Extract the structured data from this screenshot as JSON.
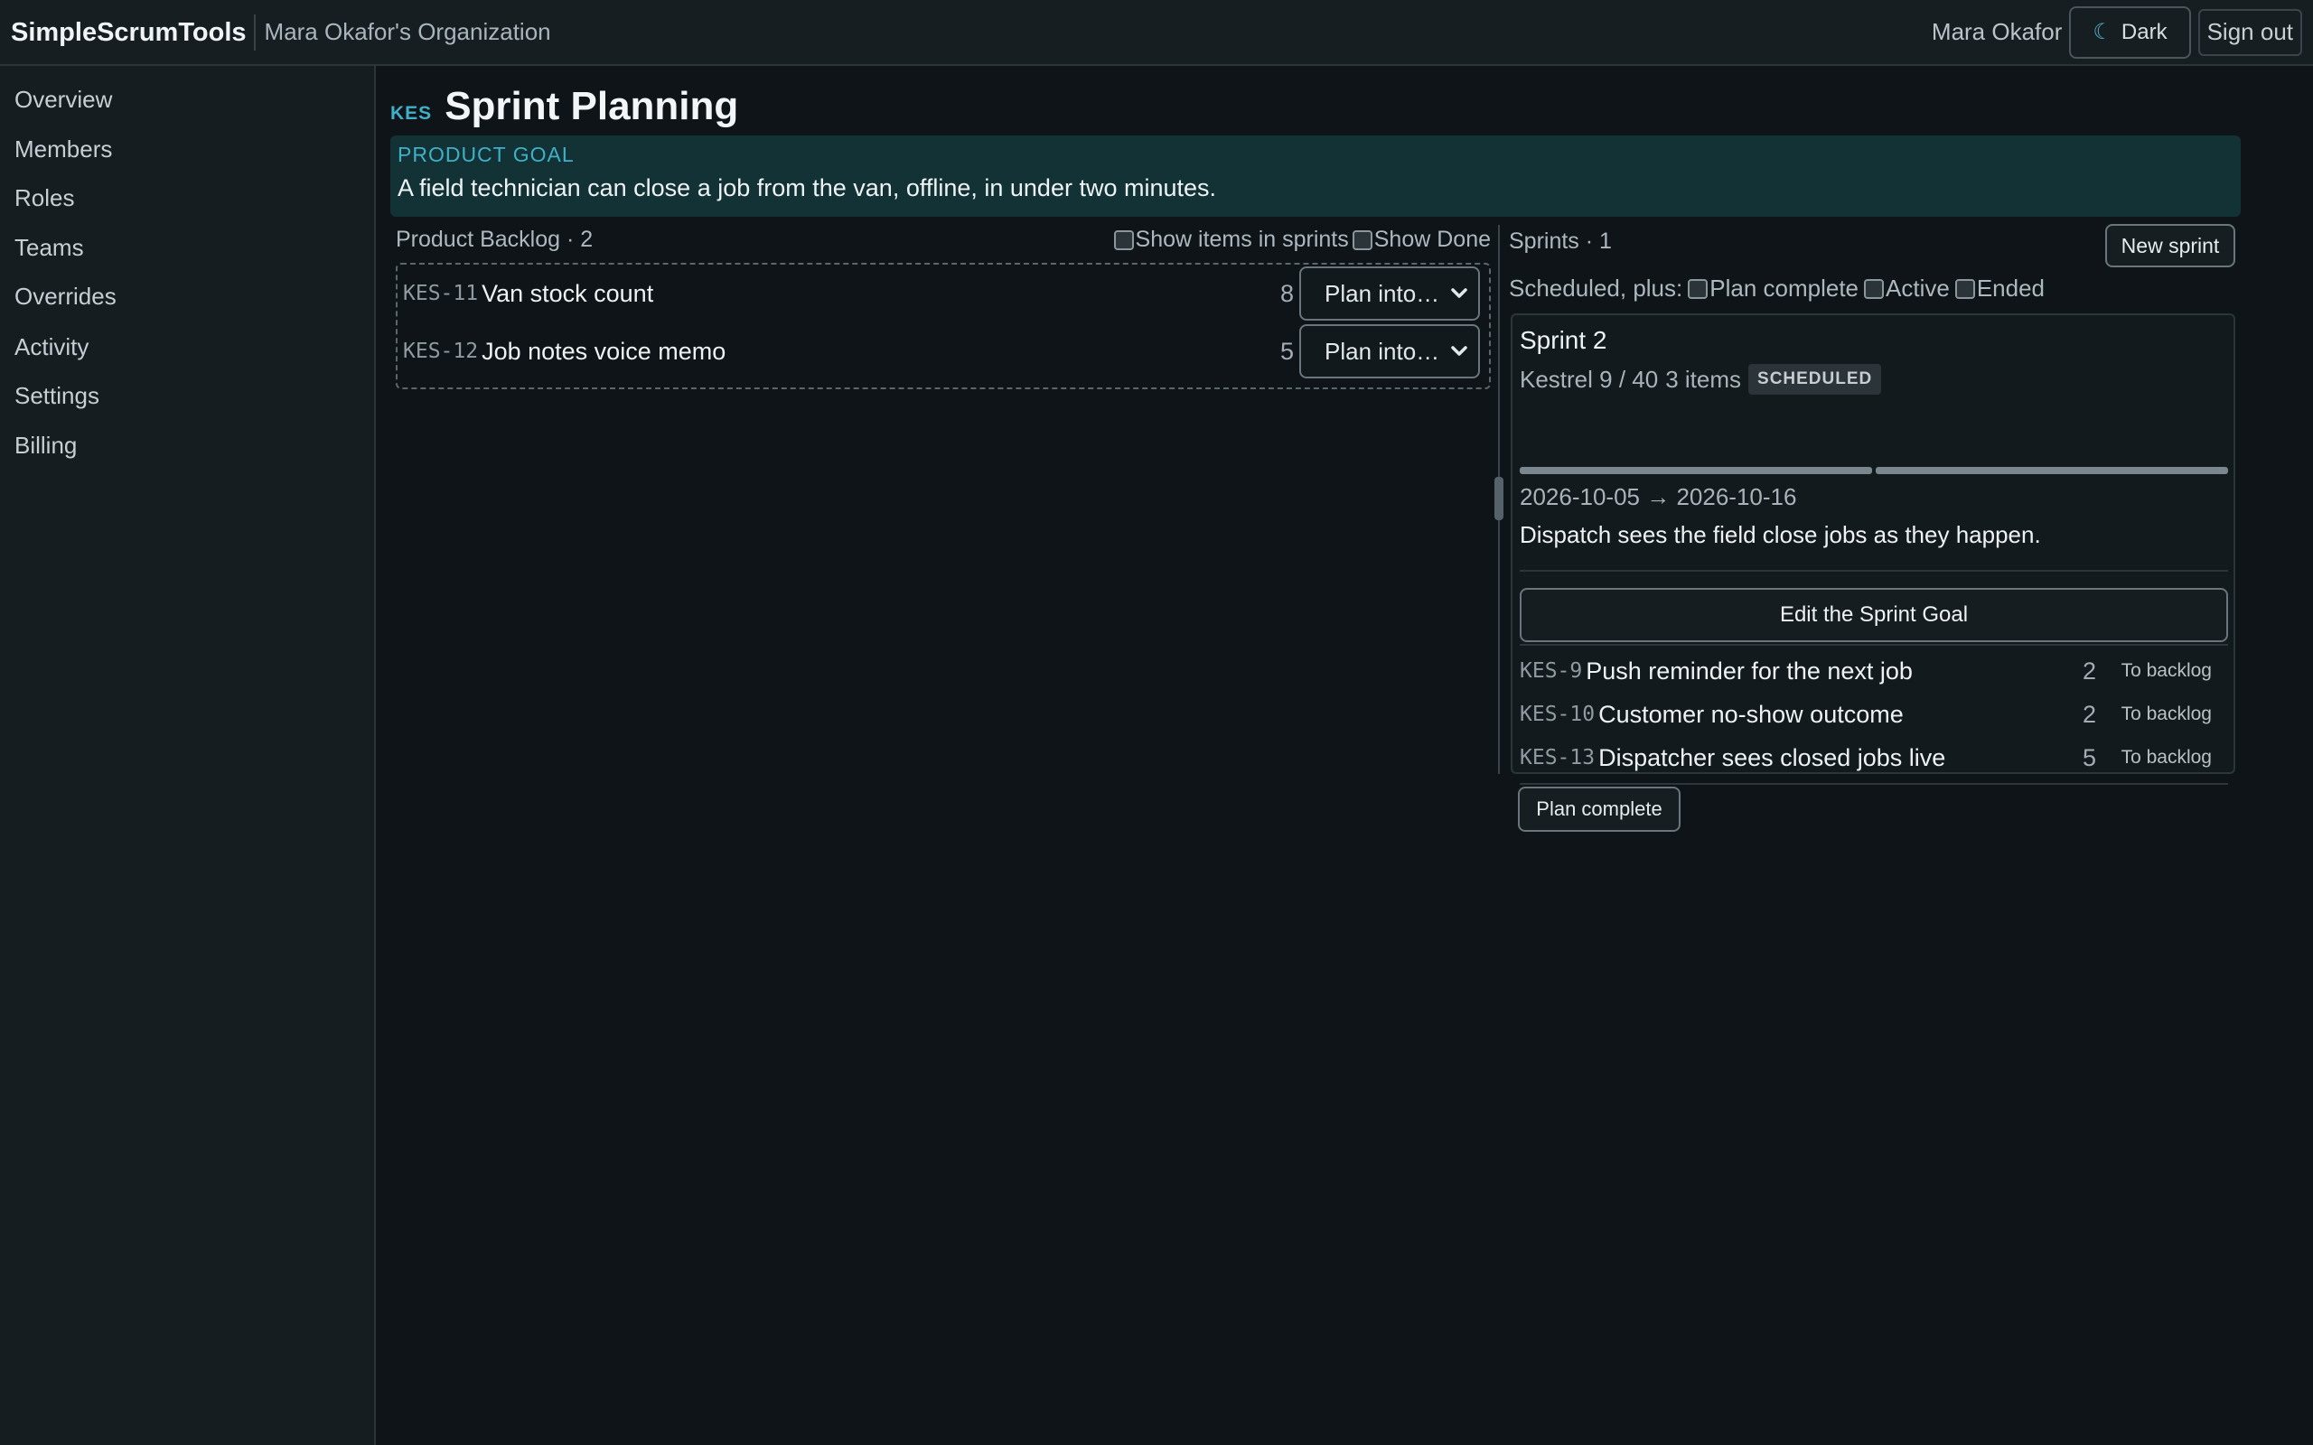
{
  "header": {
    "brand": "SimpleScrumTools",
    "org": "Mara Okafor's Organization",
    "user": "Mara Okafor",
    "theme_label": "Dark",
    "signout_label": "Sign out"
  },
  "sidebar": {
    "items": [
      {
        "label": "Overview"
      },
      {
        "label": "Members"
      },
      {
        "label": "Roles"
      },
      {
        "label": "Teams"
      },
      {
        "label": "Overrides"
      },
      {
        "label": "Activity"
      },
      {
        "label": "Settings"
      },
      {
        "label": "Billing"
      }
    ]
  },
  "page": {
    "project_key": "KES",
    "title": "Sprint Planning"
  },
  "product_goal": {
    "label": "PRODUCT GOAL",
    "text": "A field technician can close a job from the van, offline, in under two minutes."
  },
  "backlog": {
    "title": "Product Backlog · 2",
    "filters": {
      "show_in_sprints": "Show items in sprints",
      "show_done": "Show Done"
    },
    "items": [
      {
        "key": "KES-11",
        "title": "Van stock count",
        "points": "8",
        "plan_label": "Plan into…"
      },
      {
        "key": "KES-12",
        "title": "Job notes voice memo",
        "points": "5",
        "plan_label": "Plan into…"
      }
    ]
  },
  "sprints": {
    "title": "Sprints · 1",
    "new_sprint_label": "New sprint",
    "filter_prefix": "Scheduled, plus:",
    "filters": {
      "plan_complete": "Plan complete",
      "active": "Active",
      "ended": "Ended"
    },
    "card": {
      "name": "Sprint 2",
      "team_capacity": "Kestrel 9 / 40",
      "item_count": "3 items",
      "status": "SCHEDULED",
      "start_date": "2026-10-05",
      "arrow": "→",
      "end_date": "2026-10-16",
      "goal": "Dispatch sees the field close jobs as they happen.",
      "edit_goal_label": "Edit the Sprint Goal",
      "items": [
        {
          "key": "KES-9",
          "title": "Push reminder for the next job",
          "points": "2",
          "action": "To backlog"
        },
        {
          "key": "KES-10",
          "title": "Customer no-show outcome",
          "points": "2",
          "action": "To backlog"
        },
        {
          "key": "KES-13",
          "title": "Dispatcher sees closed jobs live",
          "points": "5",
          "action": "To backlog"
        }
      ],
      "plan_complete_label": "Plan complete"
    }
  },
  "colors": {
    "accent": "#3fb0c7",
    "goal_background": "#123235",
    "page_background": "#0e1417"
  }
}
